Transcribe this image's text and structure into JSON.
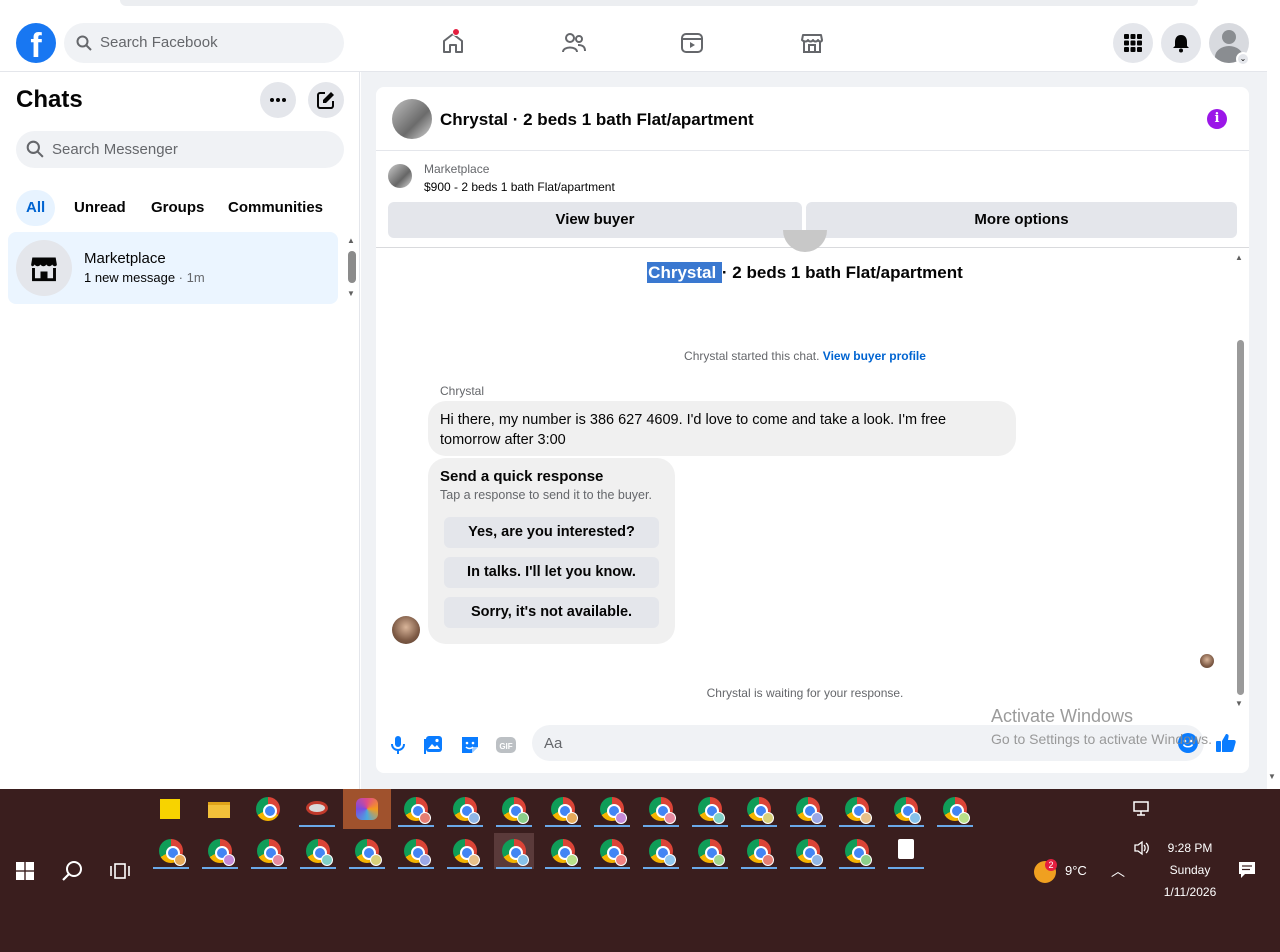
{
  "topnav": {
    "search_placeholder": "Search Facebook"
  },
  "sidebar": {
    "title": "Chats",
    "search_placeholder": "Search Messenger",
    "filters": [
      "All",
      "Unread",
      "Groups",
      "Communities"
    ],
    "active_filter": "All",
    "chat": {
      "name": "Marketplace",
      "preview": "1 new message",
      "time": " · 1m"
    }
  },
  "conversation": {
    "header_title": "Chrystal · 2 beds 1 bath Flat/apartment",
    "listing_source": "Marketplace",
    "listing_price": "$900 - 2 beds 1 bath Flat/apartment",
    "view_buyer": "View buyer",
    "more_options": "More options",
    "title_highlight": "Chrystal ",
    "title_rest": "· 2 beds 1 bath Flat/apartment",
    "started_text": "Chrystal started this chat. ",
    "started_link": "View buyer profile",
    "sender_name": "Chrystal",
    "message": "Hi there, my number is 386  627 4609.  I'd love to come and take a look.  I'm free tomorrow after 3:00",
    "quick_title": "Send a quick response",
    "quick_sub": "Tap a response to send it to the buyer.",
    "quick_responses": [
      "Yes, are you interested?",
      "In talks. I'll let you know.",
      "Sorry, it's not available."
    ],
    "waiting": "Chrystal is waiting for your response.",
    "composer_placeholder": "Aa"
  },
  "watermark": {
    "line1": "Activate Windows",
    "line2": "Go to Settings to activate Windows."
  },
  "taskbar": {
    "temperature": "9°C",
    "weather_badge": "2",
    "time": "9:28 PM",
    "day": "Sunday",
    "date": "1/11/2026"
  },
  "colors": {
    "accent": "#1877f2",
    "link": "#0064d1",
    "highlight": "#3a78d0",
    "info": "#9b16e8",
    "taskbar": "#3a1e1e"
  }
}
